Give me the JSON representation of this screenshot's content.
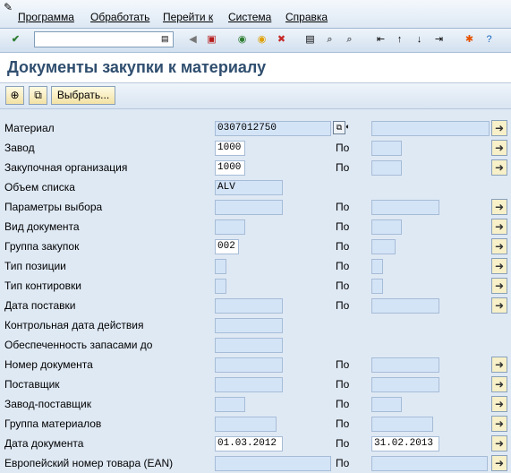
{
  "menu": [
    "Программа",
    "Обработать",
    "Перейти к",
    "Система",
    "Справка"
  ],
  "toolbar": {
    "icons": [
      "window-icon",
      "enter-icon",
      "save-icon",
      "back-icon",
      "exit-icon",
      "cancel-icon",
      "print-icon",
      "find-icon",
      "find-next-icon",
      "first-page-icon",
      "prev-page-icon",
      "next-page-icon",
      "last-page-icon",
      "new-session-icon",
      "help-icon"
    ]
  },
  "title": "Документы закупки к материалу",
  "app_toolbar": {
    "select_label": "Выбрать..."
  },
  "po_label": "По",
  "rows": [
    {
      "label": "Материал",
      "from": "0307012750",
      "to": ""
    },
    {
      "label": "Завод",
      "from": "1000",
      "to": ""
    },
    {
      "label": "Закупочная организация",
      "from": "1000",
      "to": ""
    },
    {
      "label": "Объем списка",
      "from": "ALV"
    },
    {
      "label": "Параметры выбора",
      "from": "",
      "to": ""
    },
    {
      "label": "Вид документа",
      "from": "",
      "to": ""
    },
    {
      "label": "Группа закупок",
      "from": "002",
      "to": ""
    },
    {
      "label": "Тип позиции",
      "from": "",
      "to": ""
    },
    {
      "label": "Тип контировки",
      "from": "",
      "to": ""
    },
    {
      "label": "Дата поставки",
      "from": "",
      "to": ""
    },
    {
      "label": "Контрольная дата действия",
      "from": ""
    },
    {
      "label": "Обеспеченность запасами до",
      "from": ""
    },
    {
      "label": "Номер документа",
      "from": "",
      "to": ""
    },
    {
      "label": "Поставщик",
      "from": "",
      "to": ""
    },
    {
      "label": "Завод-поставщик",
      "from": "",
      "to": ""
    },
    {
      "label": "Группа материалов",
      "from": "",
      "to": ""
    },
    {
      "label": "Дата документа",
      "from": "01.03.2012",
      "to": "31.02.2013"
    },
    {
      "label": "Европейский номер товара (EAN)",
      "from": "",
      "to": ""
    }
  ]
}
